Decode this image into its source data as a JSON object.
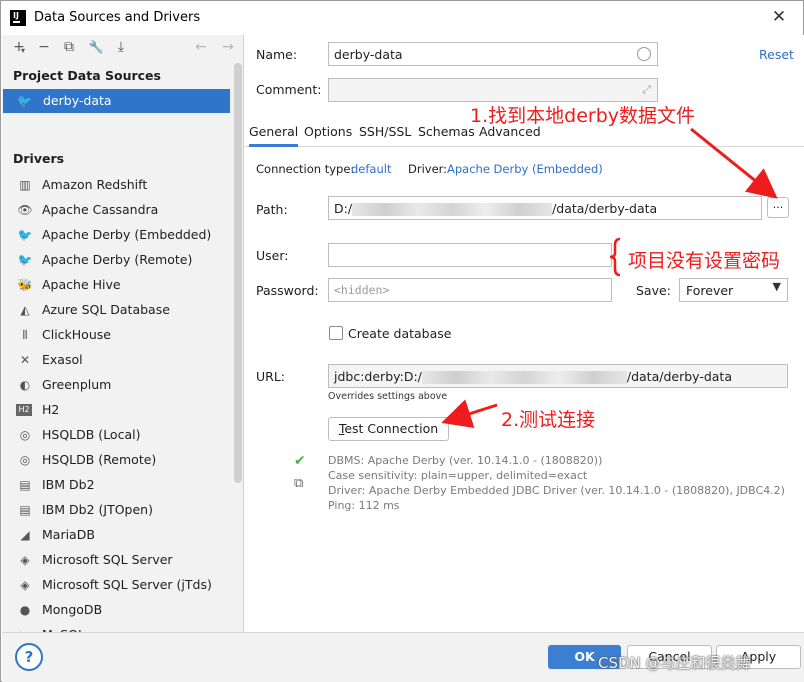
{
  "window": {
    "title": "Data Sources and Drivers"
  },
  "toolbar": {
    "add": "+",
    "add_caret": "▾",
    "remove": "−",
    "duplicate": "⧉",
    "settings": "🔧",
    "import": "⤓",
    "back": "←",
    "forward": "→"
  },
  "sidebar": {
    "project_title": "Project Data Sources",
    "selected_source": "derby-data",
    "drivers_title": "Drivers",
    "drivers": [
      {
        "label": "Amazon Redshift",
        "icon": "redshift-icon",
        "glyph": "▥"
      },
      {
        "label": "Apache Cassandra",
        "icon": "cassandra-icon",
        "glyph": "👁"
      },
      {
        "label": "Apache Derby (Embedded)",
        "icon": "derby-icon",
        "glyph": "🐦"
      },
      {
        "label": "Apache Derby (Remote)",
        "icon": "derby-icon",
        "glyph": "🐦"
      },
      {
        "label": "Apache Hive",
        "icon": "hive-icon",
        "glyph": "🐝"
      },
      {
        "label": "Azure SQL Database",
        "icon": "azure-icon",
        "glyph": "◭"
      },
      {
        "label": "ClickHouse",
        "icon": "clickhouse-icon",
        "glyph": "⦀"
      },
      {
        "label": "Exasol",
        "icon": "exasol-icon",
        "glyph": "✕"
      },
      {
        "label": "Greenplum",
        "icon": "greenplum-icon",
        "glyph": "◐"
      },
      {
        "label": "H2",
        "icon": "h2-icon",
        "glyph": "H2"
      },
      {
        "label": "HSQLDB (Local)",
        "icon": "hsqldb-icon",
        "glyph": "◎"
      },
      {
        "label": "HSQLDB (Remote)",
        "icon": "hsqldb-icon",
        "glyph": "◎"
      },
      {
        "label": "IBM Db2",
        "icon": "ibm-icon",
        "glyph": "▤"
      },
      {
        "label": "IBM Db2 (JTOpen)",
        "icon": "ibm-icon",
        "glyph": "▤"
      },
      {
        "label": "MariaDB",
        "icon": "mariadb-icon",
        "glyph": "◢"
      },
      {
        "label": "Microsoft SQL Server",
        "icon": "mssql-icon",
        "glyph": "◈"
      },
      {
        "label": "Microsoft SQL Server (jTds)",
        "icon": "mssql-icon",
        "glyph": "◈"
      },
      {
        "label": "MongoDB",
        "icon": "mongodb-icon",
        "glyph": "●"
      },
      {
        "label": "MySQL",
        "icon": "mysql-icon",
        "glyph": "◣"
      }
    ]
  },
  "form": {
    "name_label": "Name:",
    "name_value": "derby-data",
    "comment_label": "Comment:",
    "reset": "Reset",
    "tabs": [
      "General",
      "Options",
      "SSH/SSL",
      "Schemas",
      "Advanced"
    ],
    "active_tab": "General",
    "connection_type_label": "Connection type:",
    "connection_type_value": "default",
    "driver_label": "Driver:",
    "driver_value": "Apache Derby (Embedded)",
    "path_label": "Path:",
    "path_prefix": "D:/",
    "path_suffix": "/data/derby-data",
    "browse": "...",
    "user_label": "User:",
    "user_value": "",
    "password_label": "Password:",
    "password_placeholder": "<hidden>",
    "save_label": "Save:",
    "save_value": "Forever",
    "create_db_label": "Create database",
    "url_label": "URL:",
    "url_prefix": "jdbc:derby:D:/",
    "url_suffix": "/data/derby-data",
    "url_note": "Overrides settings above",
    "test_connection": "Test Connection",
    "test_connection_first": "T",
    "test_connection_rest": "est Connection",
    "result_lines": [
      "DBMS: Apache Derby (ver. 10.14.1.0 - (1808820))",
      "Case sensitivity: plain=upper, delimited=exact",
      "Driver: Apache Derby Embedded JDBC Driver (ver. 10.14.1.0 - (1808820), JDBC4.2)",
      "Ping: 112 ms"
    ]
  },
  "footer": {
    "help": "?",
    "ok": "OK",
    "cancel": "Cancel",
    "apply": "Apply",
    "watermark": "CSDN @与庄和很类舞"
  },
  "annotations": {
    "step1": "1.找到本地derby数据文件",
    "note": "项目没有设置密码",
    "step2": "2.测试连接"
  },
  "colors": {
    "selection": "#2f75c9",
    "link": "#2f6fc6",
    "ok_button": "#3c7fd1",
    "annotation": "#ee1c1c",
    "success_check": "#4caf50"
  }
}
